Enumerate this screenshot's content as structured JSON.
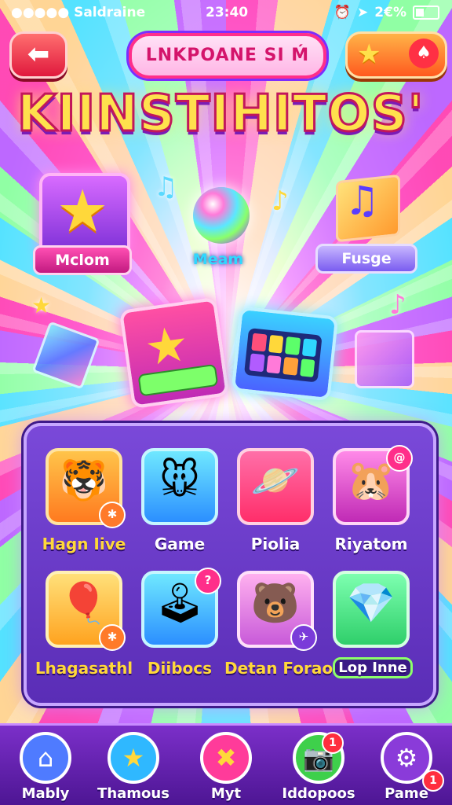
{
  "status_bar": {
    "carrier": "●●●●● Saldraine",
    "time": "23:40",
    "battery": "2€%"
  },
  "header": {
    "back_icon": "arrow-left-icon",
    "title": "LNKPOANE SI Ḿ",
    "reward_icon": "star-icon"
  },
  "logo": "KIINSTIHITOS'",
  "features": [
    {
      "label": "Mclom",
      "icon": "star-icon"
    },
    {
      "label": "Meam",
      "icon": "orb-icon"
    },
    {
      "label": "Fusge",
      "icon": "music-cube-icon"
    }
  ],
  "grid": {
    "items": [
      {
        "label": "Hagn Iive",
        "icon": "tiger-icon",
        "color": "#ff9a1f"
      },
      {
        "label": "Game",
        "icon": "mouse-icon",
        "color": "#2fd8ff"
      },
      {
        "label": "Piolia",
        "icon": "planet-icon",
        "color": "#ff3b7a"
      },
      {
        "label": "Riyatom",
        "icon": "hamster-icon",
        "color": "#ff4fd8"
      },
      {
        "label": "Lhagasathl",
        "icon": "balloon-icon",
        "color": "#ffb92e"
      },
      {
        "label": "Diibocs",
        "icon": "joystick-icon",
        "color": "#2fd8ff"
      },
      {
        "label": "Detan Forao",
        "icon": "bear-icon",
        "color": "#ff7ad9"
      },
      {
        "label": "Lop Inne",
        "icon": "crystal-icon",
        "color": "#5cff6a"
      }
    ]
  },
  "nav": {
    "items": [
      {
        "label": "Mably",
        "icon": "home-icon",
        "color": "#4f7bff"
      },
      {
        "label": "Thamous",
        "icon": "star-icon",
        "color": "#ff4fd8"
      },
      {
        "label": "Myt",
        "icon": "cross-icon",
        "color": "#ff3b9a"
      },
      {
        "label": "Iddopoos",
        "icon": "camera-icon",
        "color": "#3ed04b",
        "badge": "1"
      },
      {
        "label": "Pame",
        "icon": "gear-icon",
        "color": "#8a3bd9",
        "badge": "1"
      }
    ]
  }
}
